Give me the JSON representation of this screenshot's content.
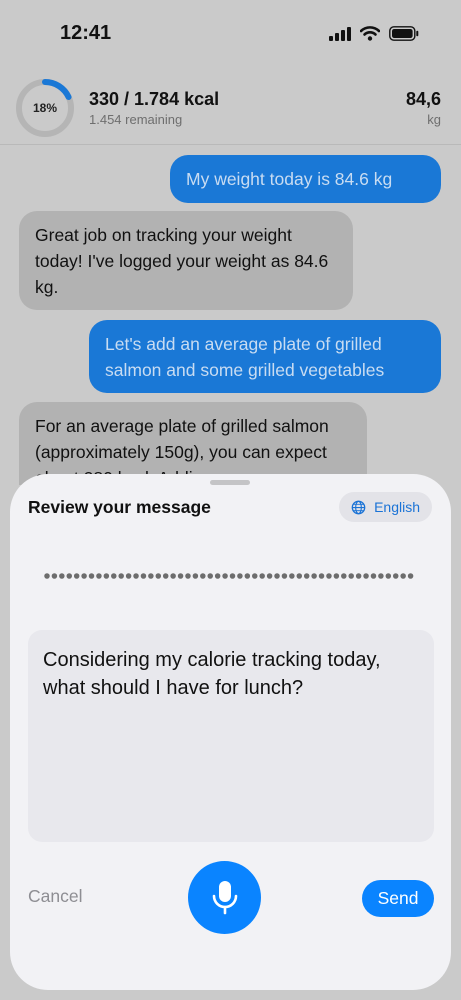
{
  "status_bar": {
    "time": "12:41"
  },
  "header": {
    "progress_percent": 18,
    "progress_label": "18%",
    "kcal": "330 / 1.784 kcal",
    "remaining": "1.454 remaining",
    "weight_value": "84,6",
    "weight_unit": "kg"
  },
  "chat": {
    "messages": [
      {
        "role": "user",
        "text": "My weight today is 84.6 kg"
      },
      {
        "role": "assistant",
        "text": "Great job on tracking your weight today! I've logged your weight as 84.6 kg."
      },
      {
        "role": "user",
        "text": "Let's add an average plate of grilled salmon and some grilled vegetables"
      },
      {
        "role": "assistant",
        "text": "For an average plate of grilled salmon (approximately 150g), you can expect about 280 kcal. Adding"
      }
    ]
  },
  "sheet": {
    "title": "Review your message",
    "language": "English",
    "message": "Considering my calorie tracking today, what should I have for lunch?",
    "cancel_label": "Cancel",
    "send_label": "Send"
  },
  "colors": {
    "accent": "#0a84ff",
    "ring_track": "#b5b5b5",
    "ring_fill": "#1a78d6"
  }
}
